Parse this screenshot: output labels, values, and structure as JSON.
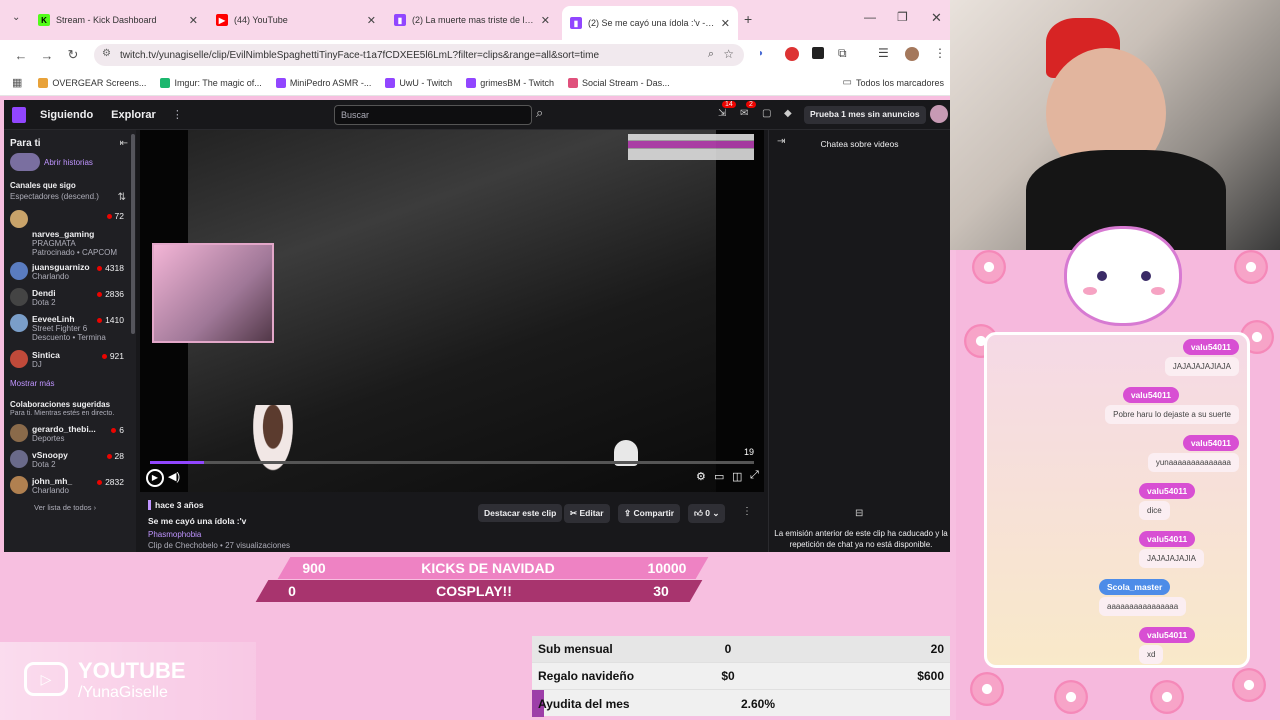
{
  "browser": {
    "tabs": [
      {
        "title": "Stream - Kick Dashboard",
        "icon": "kick-icon",
        "color": "#53fc18"
      },
      {
        "title": "(44) YouTube",
        "icon": "youtube-icon",
        "color": "#ff0000"
      },
      {
        "title": "(2) La muerte mas triste de la vi",
        "icon": "twitch-icon",
        "color": "#9146ff"
      },
      {
        "title": "(2) Se me cayó una ídola :'v - Tw",
        "icon": "twitch-icon",
        "color": "#9146ff"
      }
    ],
    "url": "twitch.tv/yunagiselle/clip/EvilNimbleSpaghettiTinyFace-t1a7fCDXEE5l6LmL?filter=clips&range=all&sort=time",
    "bookmarks": [
      "OVERGEAR Screens...",
      "Imgur: The magic of...",
      "MiniPedro ASMR -...",
      "UwU - Twitch",
      "grimesBM - Twitch",
      "Social Stream - Das..."
    ],
    "all_bookmarks": "Todos los marcadores"
  },
  "twitch": {
    "nav": {
      "following": "Siguiendo",
      "explore": "Explorar",
      "search_placeholder": "Buscar",
      "notif_count": "14",
      "inbox_count": "2",
      "trial": "Prueba 1 mes sin anuncios"
    },
    "sidebar": {
      "for_you": "Para ti",
      "open_stories": "Abrir historias",
      "followed_heading": "Canales que sigo",
      "sort_label": "Espectadores (descend.)",
      "channels": [
        {
          "name": "narves_gaming",
          "game": "PRAGMATA",
          "sub": "Patrocinado • CAPCOM",
          "viewers": "72",
          "color": "#c9a36a"
        },
        {
          "name": "juansguarnizo",
          "game": "Charlando",
          "viewers": "4318",
          "color": "#5a7cc0"
        },
        {
          "name": "Dendi",
          "game": "Dota 2",
          "viewers": "2836",
          "color": "#444"
        },
        {
          "name": "EeveeLinh",
          "game": "Street Fighter 6",
          "sub": "Descuento • Termina",
          "viewers": "1410",
          "color": "#7a9ec9"
        },
        {
          "name": "Sintica",
          "game": "DJ",
          "viewers": "921",
          "color": "#c04a3a"
        }
      ],
      "show_more": "Mostrar más",
      "suggested_heading": "Colaboraciones sugeridas",
      "suggested_sub": "Para ti. Mientras estés en directo.",
      "suggested": [
        {
          "name": "gerardo_thebi...",
          "game": "Deportes",
          "viewers": "6",
          "color": "#8a6a4a"
        },
        {
          "name": "vSnoopy",
          "game": "Dota 2",
          "viewers": "28",
          "color": "#6a6a8a"
        },
        {
          "name": "john_mh_",
          "game": "Charlando",
          "viewers": "2832",
          "color": "#b08050"
        }
      ],
      "see_all": "Ver lista de todos"
    },
    "player": {
      "time_counter": "19",
      "progress": 0.09
    },
    "clip": {
      "age": "hace 3 años",
      "title": "Se me cayó una ídola :'v",
      "game": "Phasmophobia",
      "meta": "Clip de Chechobelo • 27 visualizaciones",
      "highlight": "Destacar este clip",
      "edit": "Editar",
      "share": "Compartir",
      "likes": "0"
    },
    "chat": {
      "header": "Chatea sobre videos",
      "notice": "La emisión anterior de este clip ha caducado y la repetición de chat ya no está disponible."
    }
  },
  "overlay": {
    "kicks": {
      "left": "900",
      "label": "KICKS DE NAVIDAD",
      "right": "10000"
    },
    "cosplay": {
      "left": "0",
      "label": "COSPLAY!!",
      "right": "30"
    },
    "stats": [
      {
        "label": "Sub mensual",
        "value": "0",
        "goal": "20"
      },
      {
        "label": "Regalo navideño",
        "value": "$0",
        "goal": "$600"
      },
      {
        "label": "Ayudita del mes",
        "value": "2.60%",
        "goal": ""
      }
    ],
    "youtube": {
      "brand": "YOUTUBE",
      "handle": "/YunaGiselle"
    }
  },
  "chat_overlay": {
    "messages": [
      {
        "user": "valu54011",
        "text": "JAJAJAJAJIAJA",
        "accent": "#d84fd3"
      },
      {
        "user": "valu54011",
        "text": "Pobre haru lo dejaste a su suerte",
        "accent": "#d84fd3"
      },
      {
        "user": "valu54011",
        "text": "yunaaaaaaaaaaaaaa",
        "accent": "#d84fd3"
      },
      {
        "user": "valu54011",
        "text": "dice",
        "accent": "#d84fd3"
      },
      {
        "user": "valu54011",
        "text": "JAJAJAJAJIA",
        "accent": "#d84fd3"
      },
      {
        "user": "Scola_master",
        "text": "aaaaaaaaaaaaaaaa",
        "accent": "#4d8ce8"
      },
      {
        "user": "valu54011",
        "text": "xd",
        "accent": "#d84fd3"
      }
    ]
  }
}
